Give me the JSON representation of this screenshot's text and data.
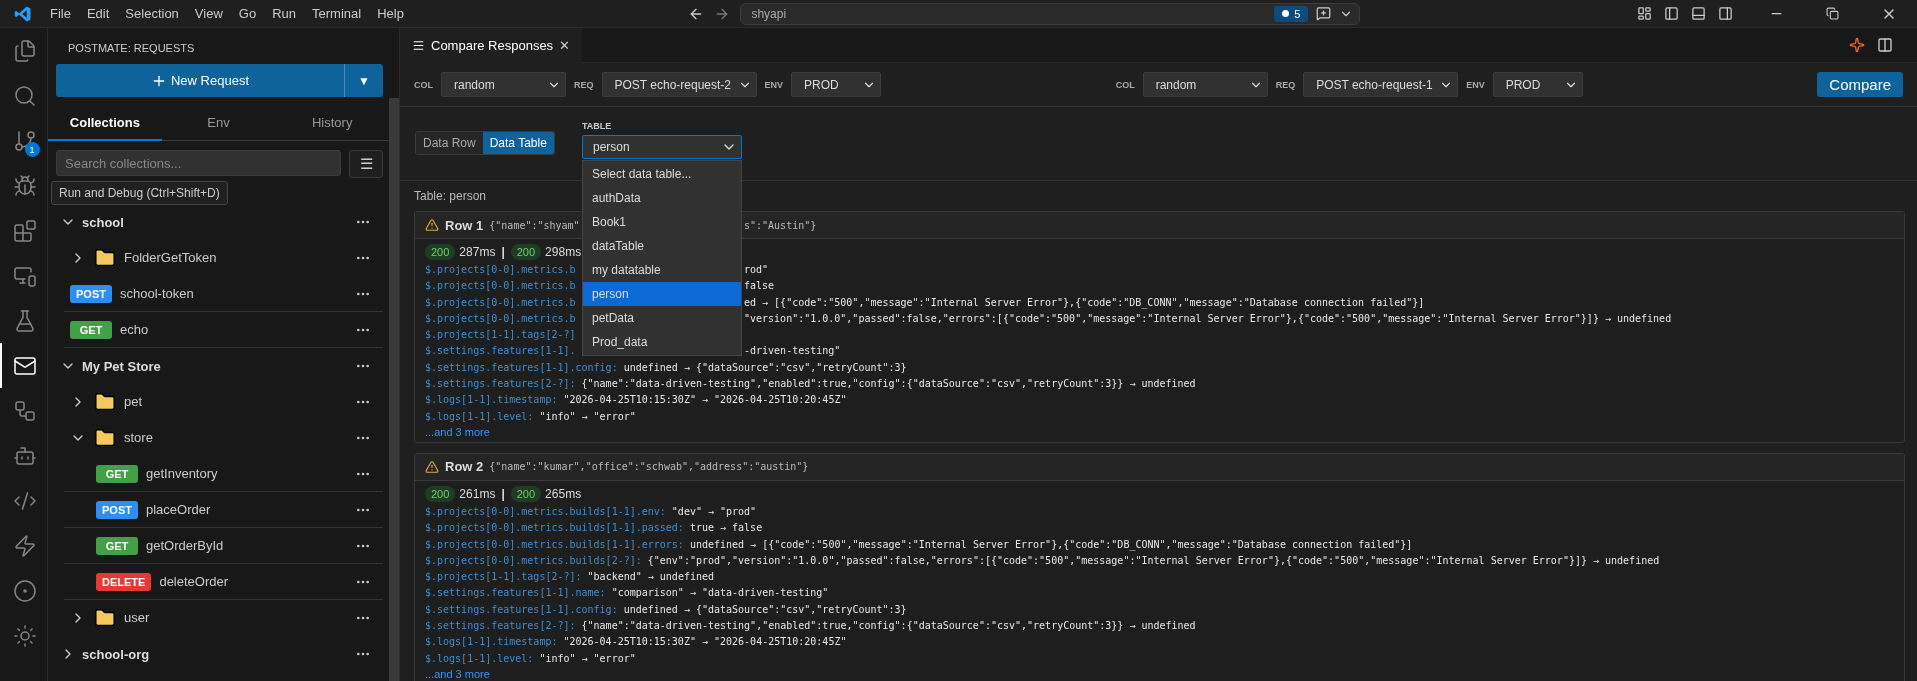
{
  "menu": [
    "File",
    "Edit",
    "Selection",
    "View",
    "Go",
    "Run",
    "Terminal",
    "Help"
  ],
  "command_center": {
    "text": "shyapi",
    "badge": "5"
  },
  "activity_bar": {
    "items": [
      {
        "kind": "files",
        "selected": false
      },
      {
        "kind": "search",
        "selected": false
      },
      {
        "kind": "source-control",
        "selected": false,
        "badge": "1"
      },
      {
        "kind": "debug",
        "selected": false
      },
      {
        "kind": "extensions",
        "selected": false
      },
      {
        "kind": "remote",
        "selected": false
      },
      {
        "kind": "testing",
        "selected": false
      },
      {
        "kind": "mail",
        "selected": true
      },
      {
        "kind": "diagram",
        "selected": false
      },
      {
        "kind": "copilot",
        "selected": false
      },
      {
        "kind": "python",
        "selected": false
      },
      {
        "kind": "bolt",
        "selected": false
      },
      {
        "kind": "kubernetes",
        "selected": false
      },
      {
        "kind": "sun",
        "selected": false
      }
    ]
  },
  "tooltip": "Run and Debug (Ctrl+Shift+D)",
  "sidebar": {
    "title": "POSTMATE: REQUESTS",
    "new_request": "New Request",
    "dropdown_arrow": "▼",
    "tabs": [
      {
        "label": "Collections",
        "selected": true
      },
      {
        "label": "Env",
        "selected": false
      },
      {
        "label": "History",
        "selected": false
      }
    ],
    "search": {
      "placeholder": "Search collections..."
    },
    "menu_button": "☰",
    "collections": [
      {
        "name": "school",
        "expanded": true,
        "children": [
          {
            "kind": "folder",
            "name": "FolderGetToken",
            "expanded": false
          },
          {
            "kind": "request",
            "method": "POST",
            "name": "school-token"
          },
          {
            "kind": "request",
            "method": "GET",
            "name": "echo"
          }
        ]
      },
      {
        "name": "My Pet Store",
        "expanded": true,
        "children": [
          {
            "kind": "folder",
            "name": "pet",
            "expanded": false
          },
          {
            "kind": "folder",
            "name": "store",
            "expanded": true,
            "children": [
              {
                "kind": "request",
                "method": "GET",
                "name": "getInventory"
              },
              {
                "kind": "request",
                "method": "POST",
                "name": "placeOrder"
              },
              {
                "kind": "request",
                "method": "GET",
                "name": "getOrderById"
              },
              {
                "kind": "request",
                "method": "DELETE",
                "name": "deleteOrder"
              }
            ]
          },
          {
            "kind": "folder",
            "name": "user",
            "expanded": false
          }
        ]
      },
      {
        "name": "school-org",
        "expanded": false
      }
    ]
  },
  "editor_tab": {
    "title": "Compare Responses",
    "close": "✕"
  },
  "compare_bar": {
    "groups": [
      {
        "col_label": "COL",
        "col": "random",
        "req_label": "REQ",
        "req": "POST echo-request-2",
        "env_label": "ENV",
        "env": "PROD"
      },
      {
        "col_label": "COL",
        "col": "random",
        "req_label": "REQ",
        "req": "POST echo-request-1",
        "env_label": "ENV",
        "env": "PROD"
      }
    ],
    "button": "Compare"
  },
  "mode_toggle": [
    {
      "label": "Data Row",
      "selected": false
    },
    {
      "label": "Data Table",
      "selected": true
    }
  ],
  "table_select": {
    "label": "TABLE",
    "value": "person",
    "expanded": true,
    "options": [
      {
        "label": "Select data table...",
        "selected": false
      },
      {
        "label": "authData",
        "selected": false
      },
      {
        "label": "Book1",
        "selected": false
      },
      {
        "label": "dataTable",
        "selected": false
      },
      {
        "label": "my datatable",
        "selected": false
      },
      {
        "label": "person",
        "selected": true
      },
      {
        "label": "petData",
        "selected": false
      },
      {
        "label": "Prod_data",
        "selected": false
      }
    ]
  },
  "table_title": "Table: person",
  "rows": [
    {
      "title": "Row 1",
      "summary_parts": [
        "{\"name\":\"shyam\"",
        "s\":\"Austin\"}"
      ],
      "status_a": "200",
      "time_a": "287ms",
      "separator": "|",
      "status_b": "200",
      "time_b": "298ms",
      "lines": [
        {
          "kind": "split",
          "path": "$.projects[0-0].metrics.b",
          "value": "rod\""
        },
        {
          "kind": "split",
          "path": "$.projects[0-0].metrics.b",
          "value": "false"
        },
        {
          "kind": "split",
          "path": "$.projects[0-0].metrics.b",
          "value": "ed → [{\"code\":\"500\",\"message\":\"Internal Server Error\"},{\"code\":\"DB_CONN\",\"message\":\"Database connection failed\"}]"
        },
        {
          "kind": "split",
          "path": "$.projects[0-0].metrics.b",
          "value": "\"version\":\"1.0.0\",\"passed\":false,\"errors\":[{\"code\":\"500\",\"message\":\"Internal Server Error\"},{\"code\":\"500\",\"message\":\"Internal Server Error\"}]} → undefined"
        },
        {
          "kind": "split",
          "path": "$.projects[1-1].tags[2-?]"
        },
        {
          "kind": "split",
          "path": "$.settings.features[1-1].",
          "value": "-driven-testing\""
        },
        {
          "kind": "full",
          "path": "$.settings.features[1-1].config:",
          "value": " undefined → {\"dataSource\":\"csv\",\"retryCount\":3}"
        },
        {
          "kind": "full",
          "path": "$.settings.features[2-?]:",
          "value": " {\"name\":\"data-driven-testing\",\"enabled\":true,\"config\":{\"dataSource\":\"csv\",\"retryCount\":3}} → undefined"
        },
        {
          "kind": "full",
          "path": "$.logs[1-1].timestamp:",
          "value": " \"2026-04-25T10:15:30Z\" → \"2026-04-25T10:20:45Z\""
        },
        {
          "kind": "full",
          "path": "$.logs[1-1].level:",
          "value": " \"info\" → \"error\""
        }
      ],
      "more": "...and 3 more"
    },
    {
      "title": "Row 2",
      "summary_parts": [
        "{\"name\":\"kumar\",\"office\":\"schwab\",\"address\":\"austin\"}"
      ],
      "status_a": "200",
      "time_a": "261ms",
      "separator": "|",
      "status_b": "200",
      "time_b": "265ms",
      "lines": [
        {
          "kind": "full",
          "path": "$.projects[0-0].metrics.builds[1-1].env:",
          "value": " \"dev\" → \"prod\""
        },
        {
          "kind": "full",
          "path": "$.projects[0-0].metrics.builds[1-1].passed:",
          "value": " true → false"
        },
        {
          "kind": "full",
          "path": "$.projects[0-0].metrics.builds[1-1].errors:",
          "value": " undefined → [{\"code\":\"500\",\"message\":\"Internal Server Error\"},{\"code\":\"DB_CONN\",\"message\":\"Database connection failed\"}]"
        },
        {
          "kind": "full",
          "path": "$.projects[0-0].metrics.builds[2-?]:",
          "value": " {\"env\":\"prod\",\"version\":\"1.0.0\",\"passed\":false,\"errors\":[{\"code\":\"500\",\"message\":\"Internal Server Error\"},{\"code\":\"500\",\"message\":\"Internal Server Error\"}]} → undefined"
        },
        {
          "kind": "full",
          "path": "$.projects[1-1].tags[2-?]:",
          "value": " \"backend\" → undefined"
        },
        {
          "kind": "full",
          "path": "$.settings.features[1-1].name:",
          "value": " \"comparison\" → \"data-driven-testing\""
        },
        {
          "kind": "full",
          "path": "$.settings.features[1-1].config:",
          "value": " undefined → {\"dataSource\":\"csv\",\"retryCount\":3}"
        },
        {
          "kind": "full",
          "path": "$.settings.features[2-?]:",
          "value": " {\"name\":\"data-driven-testing\",\"enabled\":true,\"config\":{\"dataSource\":\"csv\",\"retryCount\":3}} → undefined"
        },
        {
          "kind": "full",
          "path": "$.logs[1-1].timestamp:",
          "value": " \"2026-04-25T10:15:30Z\" → \"2026-04-25T10:20:45Z\""
        },
        {
          "kind": "full",
          "path": "$.logs[1-1].level:",
          "value": " \"info\" → \"error\""
        }
      ],
      "more": "...and 3 more"
    }
  ]
}
